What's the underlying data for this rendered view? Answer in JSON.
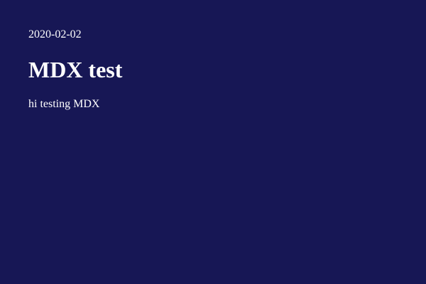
{
  "post": {
    "date": "2020-02-02",
    "title": "MDX test",
    "body": "hi testing MDX"
  },
  "colors": {
    "background": "#171755",
    "text": "#ffffff"
  }
}
